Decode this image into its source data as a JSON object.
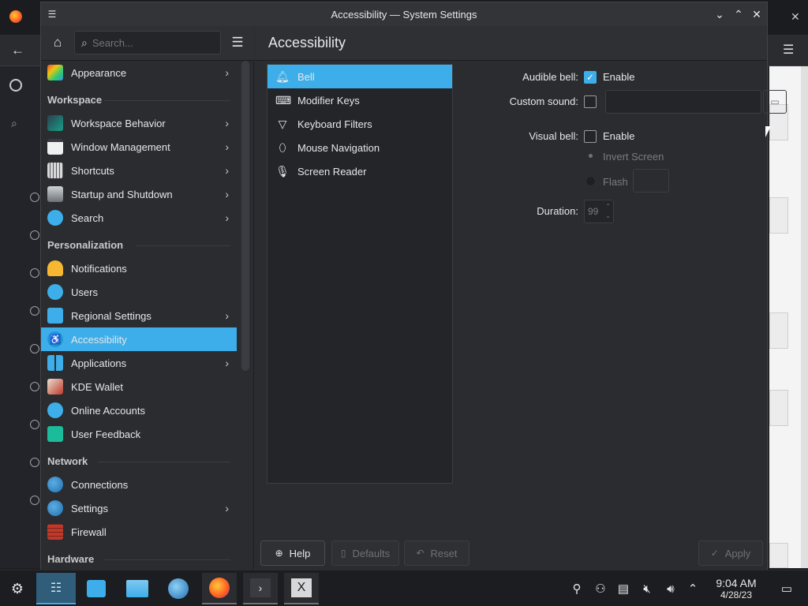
{
  "window": {
    "title": "Accessibility — System Settings"
  },
  "sidebar": {
    "search_placeholder": "Search...",
    "sections": {
      "workspace": "Workspace",
      "personalization": "Personalization",
      "network": "Network",
      "hardware": "Hardware"
    },
    "items": [
      {
        "label": "Appearance"
      },
      {
        "label": "Workspace Behavior"
      },
      {
        "label": "Window Management"
      },
      {
        "label": "Shortcuts"
      },
      {
        "label": "Startup and Shutdown"
      },
      {
        "label": "Search"
      },
      {
        "label": "Notifications"
      },
      {
        "label": "Users"
      },
      {
        "label": "Regional Settings"
      },
      {
        "label": "Accessibility"
      },
      {
        "label": "Applications"
      },
      {
        "label": "KDE Wallet"
      },
      {
        "label": "Online Accounts"
      },
      {
        "label": "User Feedback"
      },
      {
        "label": "Connections"
      },
      {
        "label": "Settings"
      },
      {
        "label": "Firewall"
      }
    ]
  },
  "content": {
    "title": "Accessibility",
    "categories": [
      {
        "label": "Bell"
      },
      {
        "label": "Modifier Keys"
      },
      {
        "label": "Keyboard Filters"
      },
      {
        "label": "Mouse Navigation"
      },
      {
        "label": "Screen Reader"
      }
    ],
    "form": {
      "audible_bell_label": "Audible bell:",
      "audible_bell_enable": "Enable",
      "custom_sound_label": "Custom sound:",
      "custom_sound_value": "",
      "visual_bell_label": "Visual bell:",
      "visual_bell_enable": "Enable",
      "invert_screen": "Invert Screen",
      "flash": "Flash",
      "duration_label": "Duration:",
      "duration_value": "99"
    },
    "buttons": {
      "help": "Help",
      "defaults": "Defaults",
      "reset": "Reset",
      "apply": "Apply"
    }
  },
  "taskbar": {
    "time": "9:04 AM",
    "date": "4/28/23"
  },
  "colors": {
    "accent": "#3daee9",
    "background": "#2a2c30"
  }
}
